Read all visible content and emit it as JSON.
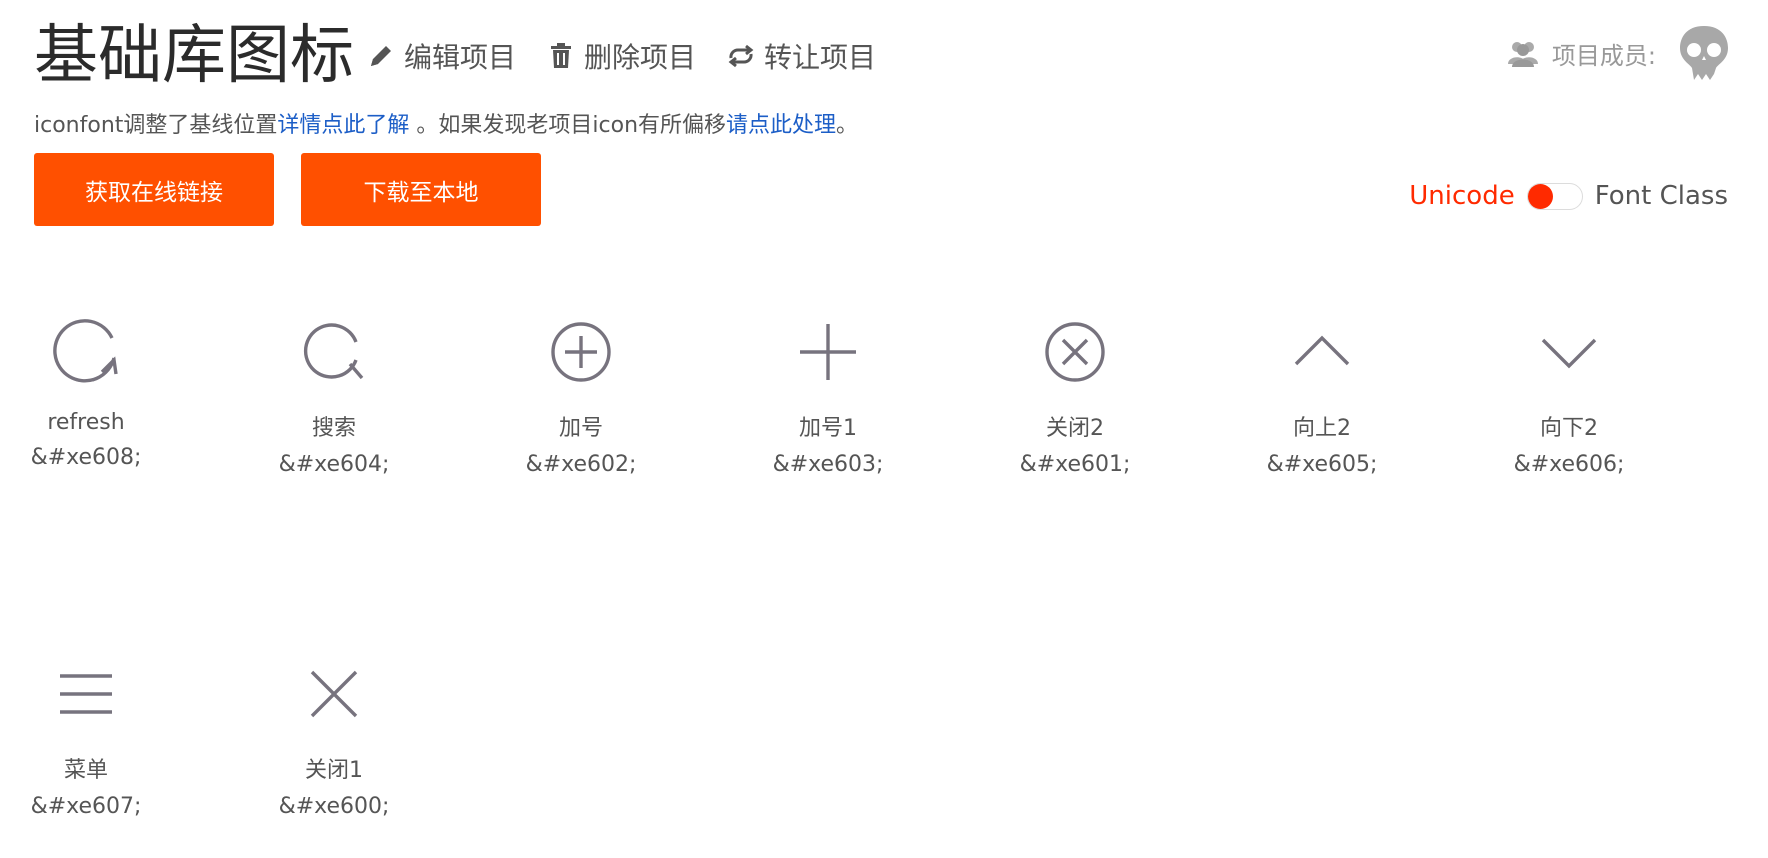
{
  "header": {
    "title": "基础库图标",
    "actions": [
      {
        "label": "编辑项目",
        "icon": "pencil-icon"
      },
      {
        "label": "删除项目",
        "icon": "trash-icon"
      },
      {
        "label": "转让项目",
        "icon": "transfer-icon"
      }
    ],
    "members_label": "项目成员:"
  },
  "notice": {
    "text1": "iconfont调整了基线位置",
    "link1": "详情点此了解",
    "text2": " 。如果发现老项目icon有所偏移",
    "link2": "请点此处理",
    "text3": "。"
  },
  "buttons": {
    "get_link": "获取在线链接",
    "download": "下载至本地"
  },
  "mode_switch": {
    "left": "Unicode",
    "right": "Font Class",
    "active": "Unicode"
  },
  "colors": {
    "accent": "#ff5000",
    "link": "#1c5ec7",
    "switch_active": "#ff2a00",
    "icon_stroke": "#77737e"
  },
  "icons": [
    {
      "name": "refresh",
      "code": "&#xe608;",
      "icon": "refresh-icon"
    },
    {
      "name": "搜索",
      "code": "&#xe604;",
      "icon": "search-icon"
    },
    {
      "name": "加号",
      "code": "&#xe602;",
      "icon": "plus-circle-icon"
    },
    {
      "name": "加号1",
      "code": "&#xe603;",
      "icon": "plus-icon"
    },
    {
      "name": "关闭2",
      "code": "&#xe601;",
      "icon": "close-circle-icon"
    },
    {
      "name": "向上2",
      "code": "&#xe605;",
      "icon": "chevron-up-icon"
    },
    {
      "name": "向下2",
      "code": "&#xe606;",
      "icon": "chevron-down-icon"
    },
    {
      "name": "菜单",
      "code": "&#xe607;",
      "icon": "menu-icon"
    },
    {
      "name": "关闭1",
      "code": "&#xe600;",
      "icon": "close-icon"
    }
  ]
}
